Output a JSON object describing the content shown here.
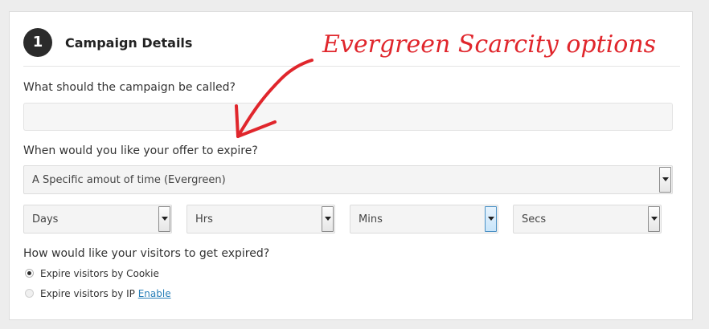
{
  "step": {
    "number": "1",
    "title": "Campaign Details"
  },
  "fields": {
    "name_label": "What should the campaign be called?",
    "name_value": "",
    "expire_label": "When would you like your offer to expire?",
    "expire_select": "A Specific amout of time (Evergreen)",
    "time_units": [
      "Days",
      "Hrs",
      "Mins",
      "Secs"
    ],
    "visitors_label": "How would like your visitors to get expired?",
    "options": [
      {
        "label": "Expire visitors by Cookie",
        "checked": true
      },
      {
        "label": "Expire visitors by IP",
        "checked": false,
        "link": "Enable"
      }
    ]
  },
  "annotation": {
    "text": "Evergreen Scarcity options",
    "color": "#e0262c"
  },
  "colors": {
    "link": "#2a80b9",
    "badge": "#2b2b2b"
  }
}
